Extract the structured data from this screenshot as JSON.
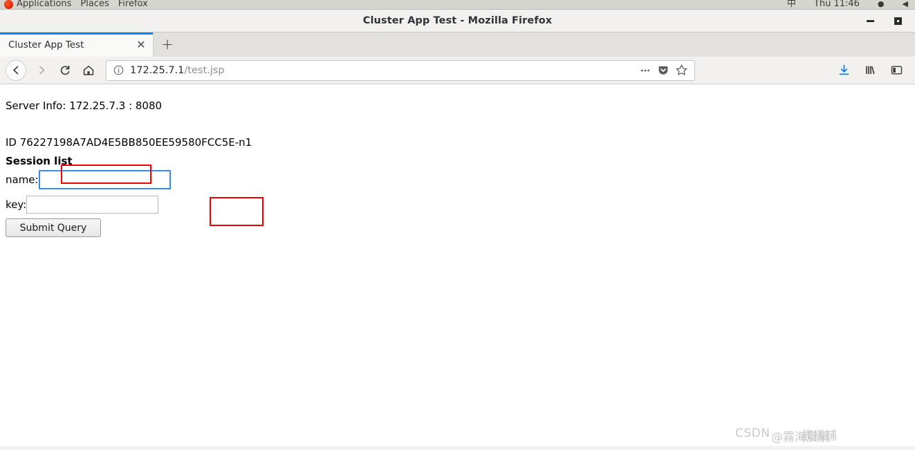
{
  "desktop_panel": {
    "logo_icon": "firefox-logo-icon",
    "menus": [
      "Applications",
      "Places",
      "Firefox"
    ],
    "input_method": "中",
    "clock": "Thu 11:46",
    "indicators": [
      "●",
      "◀"
    ]
  },
  "window": {
    "title": "Cluster App Test - Mozilla Firefox",
    "controls": {
      "minimize": "minimize-button",
      "maximize": "maximize-button"
    }
  },
  "tabbar": {
    "active_tab": "Cluster App Test",
    "close_label": "✕",
    "newtab_label": "+"
  },
  "toolbar": {
    "back": "←",
    "forward": "→",
    "reload": "⟳",
    "home": "⌂",
    "identity_icon": "info-circle-icon",
    "url_host": "172.25.7.1",
    "url_path": "/test.jsp",
    "url_full": "172.25.7.1/test.jsp",
    "page_actions": "⋯",
    "pocket": "pocket-icon",
    "bookmark": "☆",
    "downloads": "downloads-icon",
    "library": "library-icon",
    "sidebar": "sidebar-icon"
  },
  "page": {
    "server_info_label": "Server Info:",
    "server_info_value": "172.25.7.3 : 8080",
    "id_label": "ID",
    "id_value": "76227198A7AD4E5BB850EE59580FCC5E-n1",
    "id_line": "ID 76227198A7AD4E5BB850EE59580FCC5E-n1",
    "session_heading": "Session list",
    "name_label": "name:",
    "name_value": "",
    "key_label": "key:",
    "key_value": "",
    "submit_label": "Submit Query",
    "annotation_color": "#ee0000"
  },
  "watermark": {
    "line1": "CSDN",
    "line2": "@霧海晨艉",
    "line3": "舰樯铺"
  }
}
